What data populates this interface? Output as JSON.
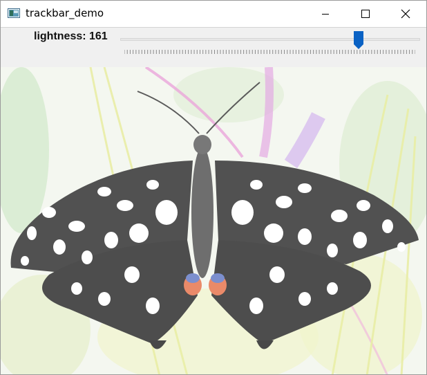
{
  "window": {
    "title": "trackbar_demo",
    "icon": "app-window-icon",
    "controls": {
      "minimize": "minimize-icon",
      "maximize": "maximize-icon",
      "close": "close-icon"
    }
  },
  "trackbar": {
    "label": "lightness: 161",
    "name": "lightness",
    "value": 161,
    "min": 0,
    "max": 200,
    "accent_color": "#0a62c4"
  },
  "image": {
    "subject": "butterfly-photo",
    "background_color": "#f3f7ee"
  }
}
